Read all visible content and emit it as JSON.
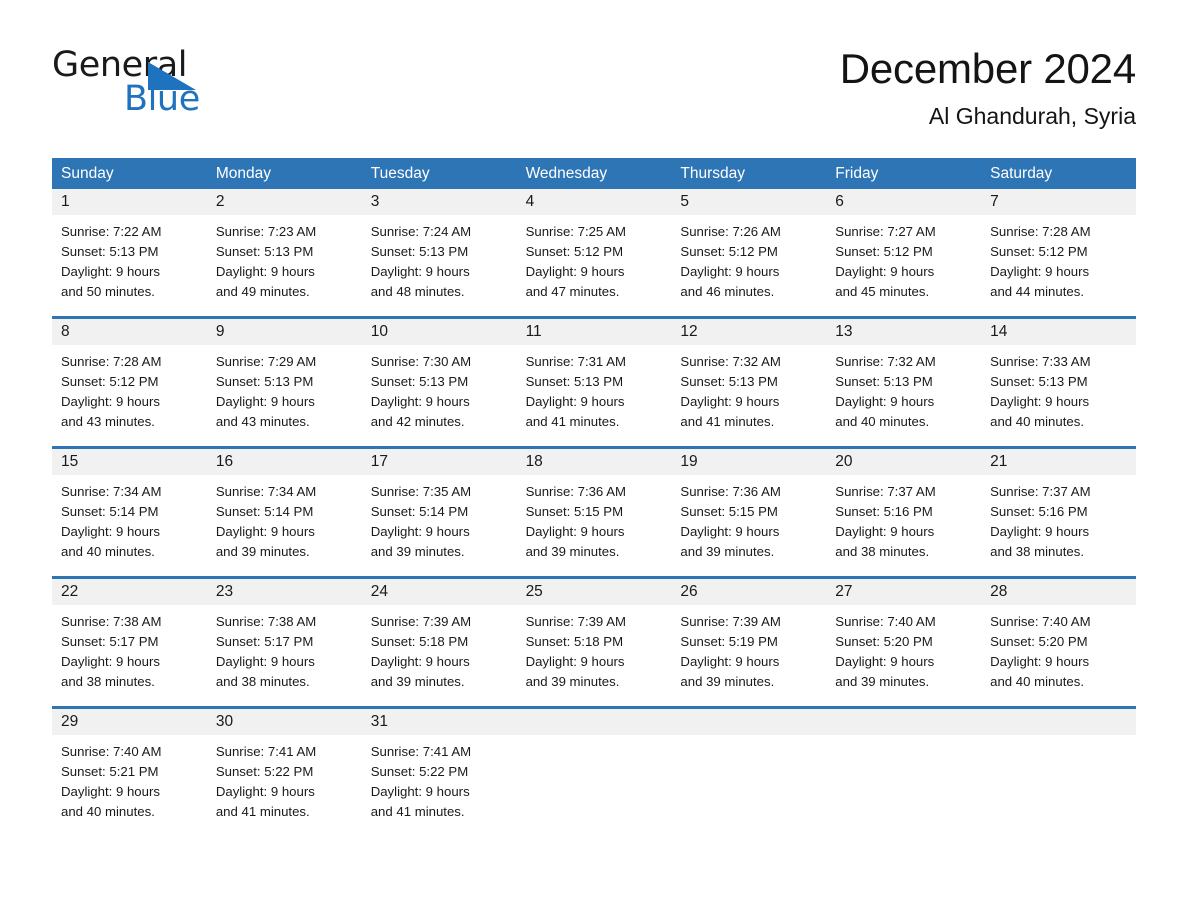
{
  "brand": {
    "name_part1": "General",
    "name_part2": "Blue",
    "accent_color": "#1f72bd"
  },
  "header": {
    "title": "December 2024",
    "subtitle": "Al Ghandurah, Syria"
  },
  "calendar": {
    "header_color": "#2e75b6",
    "weekdays": [
      "Sunday",
      "Monday",
      "Tuesday",
      "Wednesday",
      "Thursday",
      "Friday",
      "Saturday"
    ],
    "weeks": [
      [
        {
          "day": "1",
          "sunrise": "Sunrise: 7:22 AM",
          "sunset": "Sunset: 5:13 PM",
          "daylight_line1": "Daylight: 9 hours",
          "daylight_line2": "and 50 minutes."
        },
        {
          "day": "2",
          "sunrise": "Sunrise: 7:23 AM",
          "sunset": "Sunset: 5:13 PM",
          "daylight_line1": "Daylight: 9 hours",
          "daylight_line2": "and 49 minutes."
        },
        {
          "day": "3",
          "sunrise": "Sunrise: 7:24 AM",
          "sunset": "Sunset: 5:13 PM",
          "daylight_line1": "Daylight: 9 hours",
          "daylight_line2": "and 48 minutes."
        },
        {
          "day": "4",
          "sunrise": "Sunrise: 7:25 AM",
          "sunset": "Sunset: 5:12 PM",
          "daylight_line1": "Daylight: 9 hours",
          "daylight_line2": "and 47 minutes."
        },
        {
          "day": "5",
          "sunrise": "Sunrise: 7:26 AM",
          "sunset": "Sunset: 5:12 PM",
          "daylight_line1": "Daylight: 9 hours",
          "daylight_line2": "and 46 minutes."
        },
        {
          "day": "6",
          "sunrise": "Sunrise: 7:27 AM",
          "sunset": "Sunset: 5:12 PM",
          "daylight_line1": "Daylight: 9 hours",
          "daylight_line2": "and 45 minutes."
        },
        {
          "day": "7",
          "sunrise": "Sunrise: 7:28 AM",
          "sunset": "Sunset: 5:12 PM",
          "daylight_line1": "Daylight: 9 hours",
          "daylight_line2": "and 44 minutes."
        }
      ],
      [
        {
          "day": "8",
          "sunrise": "Sunrise: 7:28 AM",
          "sunset": "Sunset: 5:12 PM",
          "daylight_line1": "Daylight: 9 hours",
          "daylight_line2": "and 43 minutes."
        },
        {
          "day": "9",
          "sunrise": "Sunrise: 7:29 AM",
          "sunset": "Sunset: 5:13 PM",
          "daylight_line1": "Daylight: 9 hours",
          "daylight_line2": "and 43 minutes."
        },
        {
          "day": "10",
          "sunrise": "Sunrise: 7:30 AM",
          "sunset": "Sunset: 5:13 PM",
          "daylight_line1": "Daylight: 9 hours",
          "daylight_line2": "and 42 minutes."
        },
        {
          "day": "11",
          "sunrise": "Sunrise: 7:31 AM",
          "sunset": "Sunset: 5:13 PM",
          "daylight_line1": "Daylight: 9 hours",
          "daylight_line2": "and 41 minutes."
        },
        {
          "day": "12",
          "sunrise": "Sunrise: 7:32 AM",
          "sunset": "Sunset: 5:13 PM",
          "daylight_line1": "Daylight: 9 hours",
          "daylight_line2": "and 41 minutes."
        },
        {
          "day": "13",
          "sunrise": "Sunrise: 7:32 AM",
          "sunset": "Sunset: 5:13 PM",
          "daylight_line1": "Daylight: 9 hours",
          "daylight_line2": "and 40 minutes."
        },
        {
          "day": "14",
          "sunrise": "Sunrise: 7:33 AM",
          "sunset": "Sunset: 5:13 PM",
          "daylight_line1": "Daylight: 9 hours",
          "daylight_line2": "and 40 minutes."
        }
      ],
      [
        {
          "day": "15",
          "sunrise": "Sunrise: 7:34 AM",
          "sunset": "Sunset: 5:14 PM",
          "daylight_line1": "Daylight: 9 hours",
          "daylight_line2": "and 40 minutes."
        },
        {
          "day": "16",
          "sunrise": "Sunrise: 7:34 AM",
          "sunset": "Sunset: 5:14 PM",
          "daylight_line1": "Daylight: 9 hours",
          "daylight_line2": "and 39 minutes."
        },
        {
          "day": "17",
          "sunrise": "Sunrise: 7:35 AM",
          "sunset": "Sunset: 5:14 PM",
          "daylight_line1": "Daylight: 9 hours",
          "daylight_line2": "and 39 minutes."
        },
        {
          "day": "18",
          "sunrise": "Sunrise: 7:36 AM",
          "sunset": "Sunset: 5:15 PM",
          "daylight_line1": "Daylight: 9 hours",
          "daylight_line2": "and 39 minutes."
        },
        {
          "day": "19",
          "sunrise": "Sunrise: 7:36 AM",
          "sunset": "Sunset: 5:15 PM",
          "daylight_line1": "Daylight: 9 hours",
          "daylight_line2": "and 39 minutes."
        },
        {
          "day": "20",
          "sunrise": "Sunrise: 7:37 AM",
          "sunset": "Sunset: 5:16 PM",
          "daylight_line1": "Daylight: 9 hours",
          "daylight_line2": "and 38 minutes."
        },
        {
          "day": "21",
          "sunrise": "Sunrise: 7:37 AM",
          "sunset": "Sunset: 5:16 PM",
          "daylight_line1": "Daylight: 9 hours",
          "daylight_line2": "and 38 minutes."
        }
      ],
      [
        {
          "day": "22",
          "sunrise": "Sunrise: 7:38 AM",
          "sunset": "Sunset: 5:17 PM",
          "daylight_line1": "Daylight: 9 hours",
          "daylight_line2": "and 38 minutes."
        },
        {
          "day": "23",
          "sunrise": "Sunrise: 7:38 AM",
          "sunset": "Sunset: 5:17 PM",
          "daylight_line1": "Daylight: 9 hours",
          "daylight_line2": "and 38 minutes."
        },
        {
          "day": "24",
          "sunrise": "Sunrise: 7:39 AM",
          "sunset": "Sunset: 5:18 PM",
          "daylight_line1": "Daylight: 9 hours",
          "daylight_line2": "and 39 minutes."
        },
        {
          "day": "25",
          "sunrise": "Sunrise: 7:39 AM",
          "sunset": "Sunset: 5:18 PM",
          "daylight_line1": "Daylight: 9 hours",
          "daylight_line2": "and 39 minutes."
        },
        {
          "day": "26",
          "sunrise": "Sunrise: 7:39 AM",
          "sunset": "Sunset: 5:19 PM",
          "daylight_line1": "Daylight: 9 hours",
          "daylight_line2": "and 39 minutes."
        },
        {
          "day": "27",
          "sunrise": "Sunrise: 7:40 AM",
          "sunset": "Sunset: 5:20 PM",
          "daylight_line1": "Daylight: 9 hours",
          "daylight_line2": "and 39 minutes."
        },
        {
          "day": "28",
          "sunrise": "Sunrise: 7:40 AM",
          "sunset": "Sunset: 5:20 PM",
          "daylight_line1": "Daylight: 9 hours",
          "daylight_line2": "and 40 minutes."
        }
      ],
      [
        {
          "day": "29",
          "sunrise": "Sunrise: 7:40 AM",
          "sunset": "Sunset: 5:21 PM",
          "daylight_line1": "Daylight: 9 hours",
          "daylight_line2": "and 40 minutes."
        },
        {
          "day": "30",
          "sunrise": "Sunrise: 7:41 AM",
          "sunset": "Sunset: 5:22 PM",
          "daylight_line1": "Daylight: 9 hours",
          "daylight_line2": "and 41 minutes."
        },
        {
          "day": "31",
          "sunrise": "Sunrise: 7:41 AM",
          "sunset": "Sunset: 5:22 PM",
          "daylight_line1": "Daylight: 9 hours",
          "daylight_line2": "and 41 minutes."
        },
        {
          "day": "",
          "sunrise": "",
          "sunset": "",
          "daylight_line1": "",
          "daylight_line2": ""
        },
        {
          "day": "",
          "sunrise": "",
          "sunset": "",
          "daylight_line1": "",
          "daylight_line2": ""
        },
        {
          "day": "",
          "sunrise": "",
          "sunset": "",
          "daylight_line1": "",
          "daylight_line2": ""
        },
        {
          "day": "",
          "sunrise": "",
          "sunset": "",
          "daylight_line1": "",
          "daylight_line2": ""
        }
      ]
    ]
  }
}
